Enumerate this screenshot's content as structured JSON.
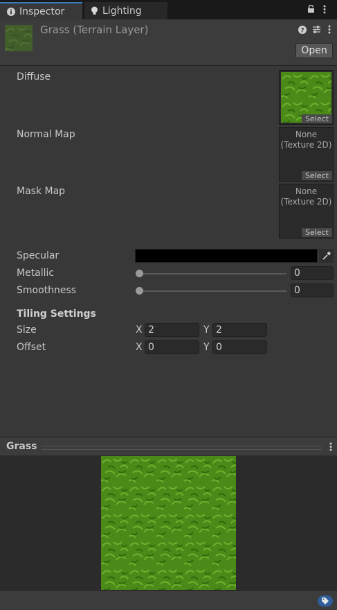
{
  "tabs": [
    {
      "label": "Inspector",
      "icon": "info-icon"
    },
    {
      "label": "Lighting",
      "icon": "light-bulb-icon"
    }
  ],
  "header": {
    "title": "Grass (Terrain Layer)",
    "open_label": "Open"
  },
  "textures": [
    {
      "label": "Diffuse",
      "value": "",
      "select_label": "Select"
    },
    {
      "label": "Normal Map",
      "value": "None\n(Texture 2D)",
      "select_label": "Select"
    },
    {
      "label": "Mask Map",
      "value": "None\n(Texture 2D)",
      "select_label": "Select"
    }
  ],
  "properties": {
    "specular": {
      "label": "Specular",
      "color": "#000000"
    },
    "metallic": {
      "label": "Metallic",
      "value": "0",
      "fraction": 0
    },
    "smoothness": {
      "label": "Smoothness",
      "value": "0",
      "fraction": 0
    }
  },
  "tiling": {
    "heading": "Tiling Settings",
    "size": {
      "label": "Size",
      "x_label": "X",
      "x": "2",
      "y_label": "Y",
      "y": "2"
    },
    "offset": {
      "label": "Offset",
      "x_label": "X",
      "x": "0",
      "y_label": "Y",
      "y": "0"
    }
  },
  "preview": {
    "title": "Grass"
  },
  "colors": {
    "accent": "#3a79bb",
    "grass_dark": "#3f7a12",
    "grass_light": "#6aa82a",
    "background": "#383838"
  }
}
